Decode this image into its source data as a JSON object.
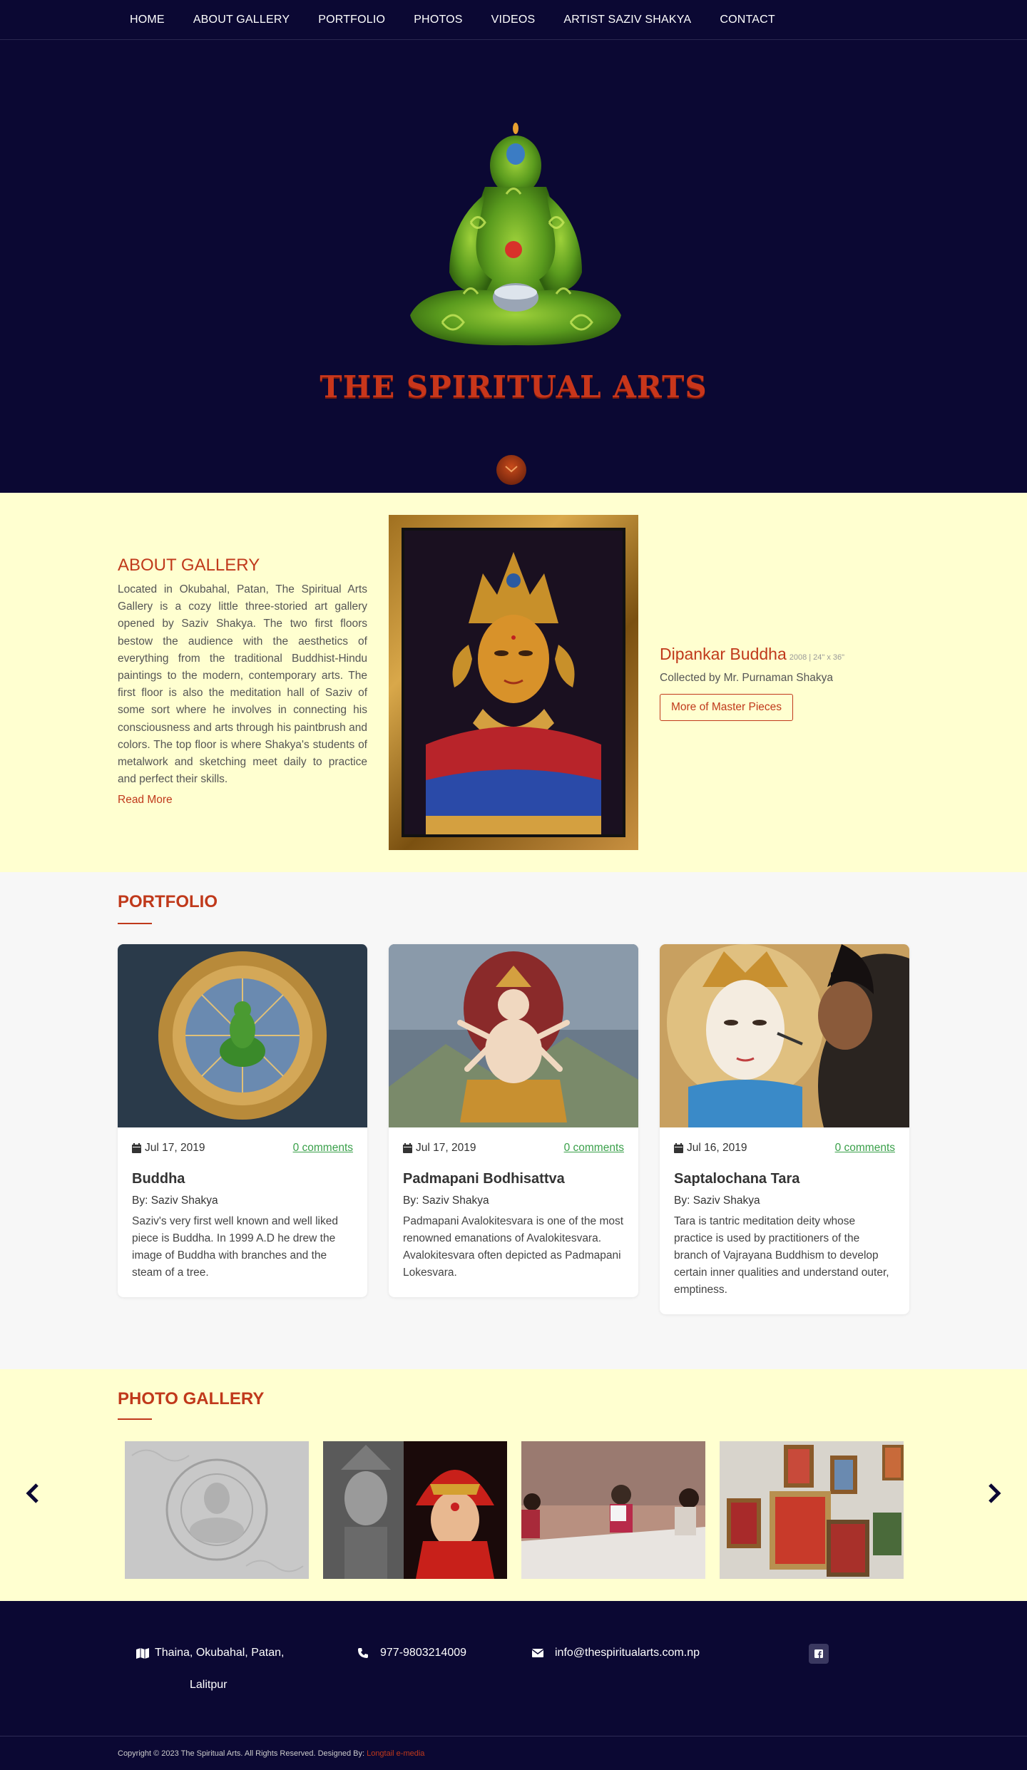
{
  "nav": {
    "items": [
      "HOME",
      "ABOUT GALLERY",
      "PORTFOLIO",
      "PHOTOS",
      "VIDEOS",
      "ARTIST SAZIV SHAKYA",
      "CONTACT"
    ]
  },
  "hero": {
    "logo_text": "THE SPIRITUAL ARTS"
  },
  "about": {
    "title": "ABOUT GALLERY",
    "text": "Located in Okubahal, Patan, The Spiritual Arts Gallery is a cozy little three-storied art gallery opened by Saziv Shakya. The two first floors bestow the audience with the aesthetics of everything from the traditional Buddhist-Hindu paintings to the modern, contemporary arts. The first floor is also the meditation hall of Saziv of some sort where he involves in connecting his consciousness and arts through his paintbrush and colors. The top floor is where Shakya's students of metalwork and sketching meet daily to practice and perfect their skills.",
    "read_more": "Read More",
    "featured": {
      "title": "Dipankar Buddha",
      "meta": "2008 | 24\" x 36\"",
      "collector": "Collected by Mr. Purnaman Shakya",
      "button": "More of Master Pieces"
    }
  },
  "portfolio": {
    "title": "PORTFOLIO",
    "cards": [
      {
        "date": "Jul 17, 2019",
        "comments": "0 comments",
        "title": "Buddha",
        "author": "By: Saziv Shakya",
        "desc": "Saziv's very first well known and well liked piece is Buddha. In 1999 A.D he drew the image of Buddha with branches and the steam of a tree."
      },
      {
        "date": "Jul 17, 2019",
        "comments": "0 comments",
        "title": "Padmapani Bodhisattva",
        "author": "By: Saziv Shakya",
        "desc": "Padmapani Avalokitesvara is one of the most renowned emanations of Avalokitesvara. Avalokitesvara often depicted as Padmapani Lokesvara."
      },
      {
        "date": "Jul 16, 2019",
        "comments": "0 comments",
        "title": "Saptalochana Tara",
        "author": "By: Saziv Shakya",
        "desc": "Tara is tantric meditation deity whose practice is used by practitioners of the branch of Vajrayana Buddhism to develop certain inner qualities and understand outer, emptiness."
      }
    ]
  },
  "gallery": {
    "title": "PHOTO GALLERY"
  },
  "footer": {
    "address_line1": "Thaina, Okubahal, Patan,",
    "address_line2": "Lalitpur",
    "phone": "977-9803214009",
    "email": "info@thespiritualarts.com.np",
    "copyright": "Copyright © 2023 The Spiritual Arts. All Rights Reserved. Designed By: ",
    "designer": "Longtail e-media"
  },
  "colors": {
    "navy": "#0b0833",
    "accent": "#c0391b",
    "cream": "#ffffd0",
    "link_green": "#3aa04a"
  }
}
